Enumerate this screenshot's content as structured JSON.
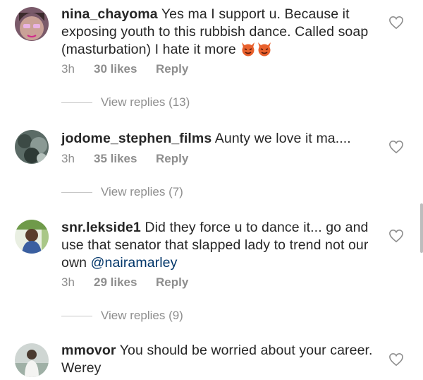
{
  "comments": [
    {
      "username": "nina_chayoma",
      "text": "Yes ma I support u. Because it exposing youth to this rubbish dance. Called soap (masturbation) I hate it more",
      "emoji": [
        "devil-face-emoji",
        "devil-face-emoji"
      ],
      "time": "3h",
      "likes": "30 likes",
      "reply_label": "Reply",
      "view_replies": "View replies (13)"
    },
    {
      "username": "jodome_stephen_films",
      "text": "Aunty we love it ma....",
      "time": "3h",
      "likes": "35 likes",
      "reply_label": "Reply",
      "view_replies": "View replies (7)"
    },
    {
      "username": "snr.lekside1",
      "text": "Did they force u to dance it... go and use that senator that slapped lady to trend not our own",
      "mention": "@nairamarley",
      "time": "3h",
      "likes": "29 likes",
      "reply_label": "Reply",
      "view_replies": "View replies (9)"
    },
    {
      "username": "mmovor",
      "text": "You should be worried about your career. Werey"
    }
  ],
  "icons": {
    "like": "heart-outline-icon"
  },
  "colors": {
    "text": "#262626",
    "meta": "#8e8e8e",
    "mention": "#003569",
    "emoji": "#e8602c"
  }
}
